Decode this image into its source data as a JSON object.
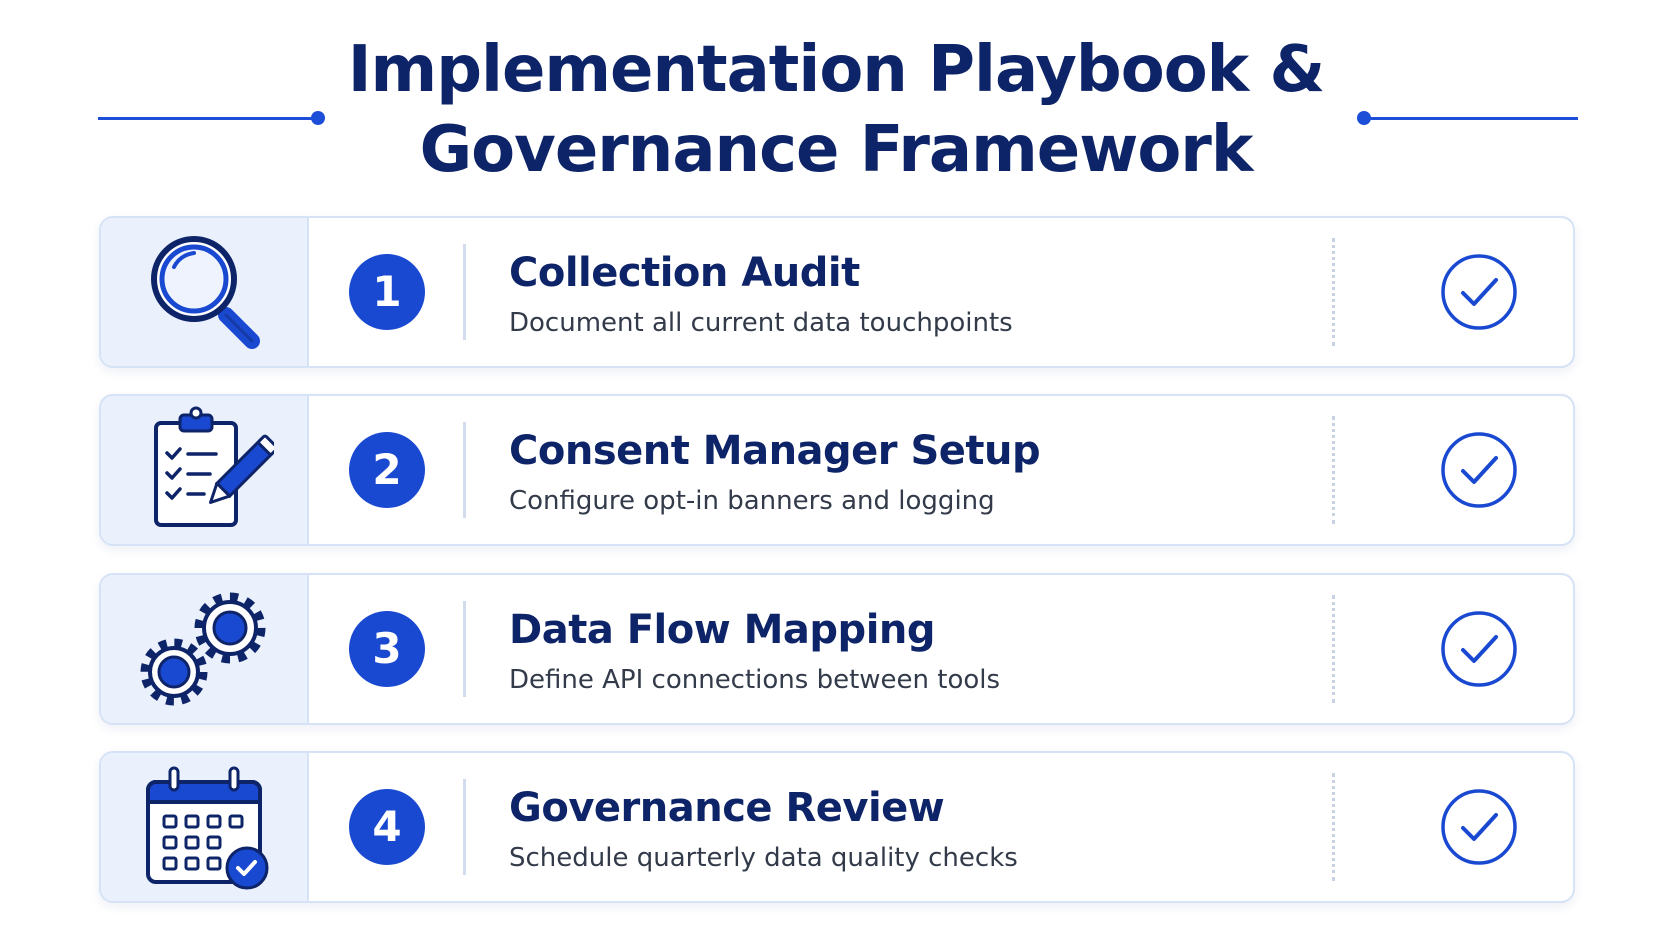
{
  "title": {
    "line1": "Implementation Playbook &",
    "line2": "Governance Framework"
  },
  "colors": {
    "primary": "#1a49d1",
    "title": "#0e2468",
    "icon_bg": "#eaf1fc",
    "border": "#d6e2f5"
  },
  "steps": [
    {
      "number": "1",
      "title": "Collection Audit",
      "description": "Document all current data touchpoints",
      "icon": "magnifying-glass-icon",
      "status": "complete"
    },
    {
      "number": "2",
      "title": "Consent Manager Setup",
      "description": "Configure opt-in banners and logging",
      "icon": "clipboard-checklist-icon",
      "status": "complete"
    },
    {
      "number": "3",
      "title": "Data Flow Mapping",
      "description": "Define API connections between tools",
      "icon": "gears-icon",
      "status": "complete"
    },
    {
      "number": "4",
      "title": "Governance Review",
      "description": "Schedule quarterly data quality checks",
      "icon": "calendar-check-icon",
      "status": "complete"
    }
  ]
}
